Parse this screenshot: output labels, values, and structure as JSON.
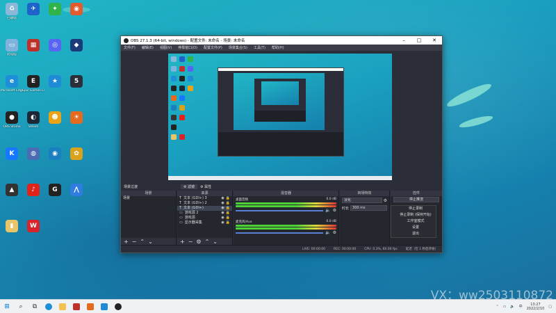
{
  "desktop_icons": [
    {
      "label": "回收站",
      "color": "#8bb7d8",
      "glyph": "♻"
    },
    {
      "label": "",
      "color": "#1e63c9",
      "glyph": "✈"
    },
    {
      "label": "",
      "color": "#2fb34a",
      "glyph": "✦"
    },
    {
      "label": "",
      "color": "#e25b2f",
      "glyph": "◉"
    },
    {
      "label": "此电脑",
      "color": "#7fb3de",
      "glyph": "▭"
    },
    {
      "label": "",
      "color": "#c0302b",
      "glyph": "▦"
    },
    {
      "label": "",
      "color": "#5865f2",
      "glyph": "◎"
    },
    {
      "label": "",
      "color": "#1b3a7a",
      "glyph": "◆"
    },
    {
      "label": "Microsoft Edge",
      "color": "#1d8fd8",
      "glyph": "e"
    },
    {
      "label": "Epic Games Launcher",
      "color": "#222222",
      "glyph": "E"
    },
    {
      "label": "",
      "color": "#1f8ad6",
      "glyph": "★"
    },
    {
      "label": "",
      "color": "#2a2f3a",
      "glyph": "5"
    },
    {
      "label": "OBS Studio",
      "color": "#222222",
      "glyph": "●"
    },
    {
      "label": "Steam",
      "color": "#1b2838",
      "glyph": "◐"
    },
    {
      "label": "",
      "color": "#e8a317",
      "glyph": "☻"
    },
    {
      "label": "",
      "color": "#e36a1e",
      "glyph": "☀"
    },
    {
      "label": "",
      "color": "#1677ff",
      "glyph": "K"
    },
    {
      "label": "",
      "color": "#4b6bb3",
      "glyph": "◍"
    },
    {
      "label": "",
      "color": "#1a7fbf",
      "glyph": "◉"
    },
    {
      "label": "",
      "color": "#d9a21b",
      "glyph": "✿"
    },
    {
      "label": "",
      "color": "#333333",
      "glyph": "▲"
    },
    {
      "label": "",
      "color": "#e2231a",
      "glyph": "♪"
    },
    {
      "label": "",
      "color": "#222222",
      "glyph": "G"
    },
    {
      "label": "",
      "color": "#2f7de1",
      "glyph": "⋀"
    },
    {
      "label": "",
      "color": "#e8c46a",
      "glyph": "▮"
    },
    {
      "label": "",
      "color": "#d8232a",
      "glyph": "W"
    }
  ],
  "watermark": "VX：ww2503110872",
  "obs": {
    "title": "OBS 27.1.3 (64-bit, windows) - 配置文件: 未命名 - 场景: 未命名",
    "menu": [
      "文件(F)",
      "编辑(E)",
      "视图(V)",
      "停靠窗口(D)",
      "配置文件(P)",
      "场景集合(S)",
      "工具(T)",
      "帮助(H)"
    ],
    "tabs": {
      "scenes_header": "场景过渡",
      "filters": "滤镜",
      "properties": "属性"
    },
    "scenes_dock": {
      "title": "场景",
      "items": [
        "场景"
      ]
    },
    "sources_dock": {
      "title": "来源",
      "items": [
        "文本 (GDI+) 3",
        "文本 (GDI+) 2",
        "文本 (GDI+)",
        "游戏源 2",
        "游戏源",
        "显示器采集"
      ]
    },
    "mixer_dock": {
      "title": "混音器",
      "channels": [
        {
          "name": "桌面音频",
          "level": "0.0 dB"
        },
        {
          "name": "麦克风/Aux",
          "level": "0.0 dB"
        }
      ]
    },
    "transitions_dock": {
      "title": "转场特效",
      "type": "淡化",
      "duration_label": "时长",
      "duration_value": "300 ms"
    },
    "controls_dock": {
      "title": "控件",
      "buttons": [
        "停止推流",
        "停止录制",
        "停止录制 (保持开始)",
        "工作室模式",
        "设置",
        "退出"
      ]
    },
    "status": {
      "live": "LIVE: 00:00:00",
      "rec": "REC: 00:00:00",
      "cpu": "CPU: 0.3%, 60.00 fps",
      "delay": "延迟（在 1 秒后开始）"
    }
  },
  "taskbar": {
    "time": "13:27",
    "date": "2022/2/10",
    "input_method": "中"
  }
}
